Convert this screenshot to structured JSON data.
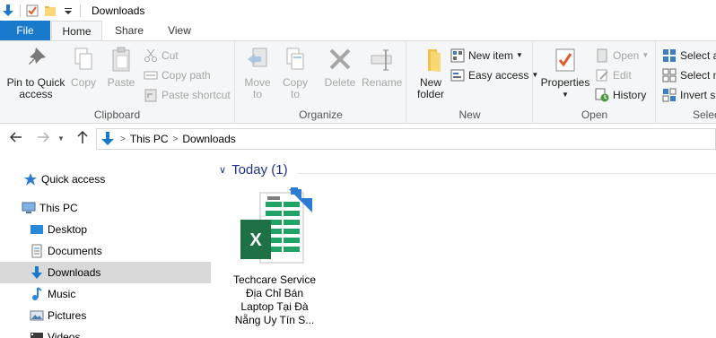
{
  "window": {
    "title": "Downloads"
  },
  "ribbon": {
    "tabs": [
      "File",
      "Home",
      "Share",
      "View"
    ],
    "clipboard": {
      "pin_label_1": "Pin to Quick",
      "pin_label_2": "access",
      "copy": "Copy",
      "paste": "Paste",
      "cut": "Cut",
      "copy_path": "Copy path",
      "paste_shortcut": "Paste shortcut",
      "group": "Clipboard"
    },
    "organize": {
      "move_to_1": "Move",
      "move_to_2": "to",
      "copy_to_1": "Copy",
      "copy_to_2": "to",
      "delete": "Delete",
      "rename": "Rename",
      "group": "Organize"
    },
    "new": {
      "new_folder_1": "New",
      "new_folder_2": "folder",
      "new_item": "New item",
      "easy_access": "Easy access",
      "group": "New"
    },
    "open": {
      "properties": "Properties",
      "open": "Open",
      "edit": "Edit",
      "history": "History",
      "group": "Open"
    },
    "select": {
      "select_all": "Select a",
      "select_none": "Select n",
      "invert": "Invert se",
      "group": "Selec"
    }
  },
  "address": {
    "crumbs": [
      "This PC",
      "Downloads"
    ]
  },
  "sidebar": {
    "items": [
      {
        "label": "Quick access",
        "icon": "star-icon"
      },
      {
        "label": "This PC",
        "icon": "computer-icon"
      },
      {
        "label": "Desktop",
        "icon": "desktop-icon"
      },
      {
        "label": "Documents",
        "icon": "documents-icon"
      },
      {
        "label": "Downloads",
        "icon": "download-arrow-icon"
      },
      {
        "label": "Music",
        "icon": "music-note-icon"
      },
      {
        "label": "Pictures",
        "icon": "pictures-icon"
      },
      {
        "label": "Videos",
        "icon": "videos-icon"
      }
    ]
  },
  "content": {
    "group_header": "Today (1)",
    "files": [
      {
        "name_lines": [
          "Techcare Service",
          "Địa Chỉ Bán",
          "Laptop Tại Đà",
          "Nẵng Uy Tín S..."
        ],
        "icon": "excel-shortcut-icon"
      }
    ]
  },
  "colors": {
    "accent": "#1979ca",
    "selected_nav": "#d9d9d9",
    "group_header": "#1e3287",
    "excel_green": "#1e7145"
  }
}
